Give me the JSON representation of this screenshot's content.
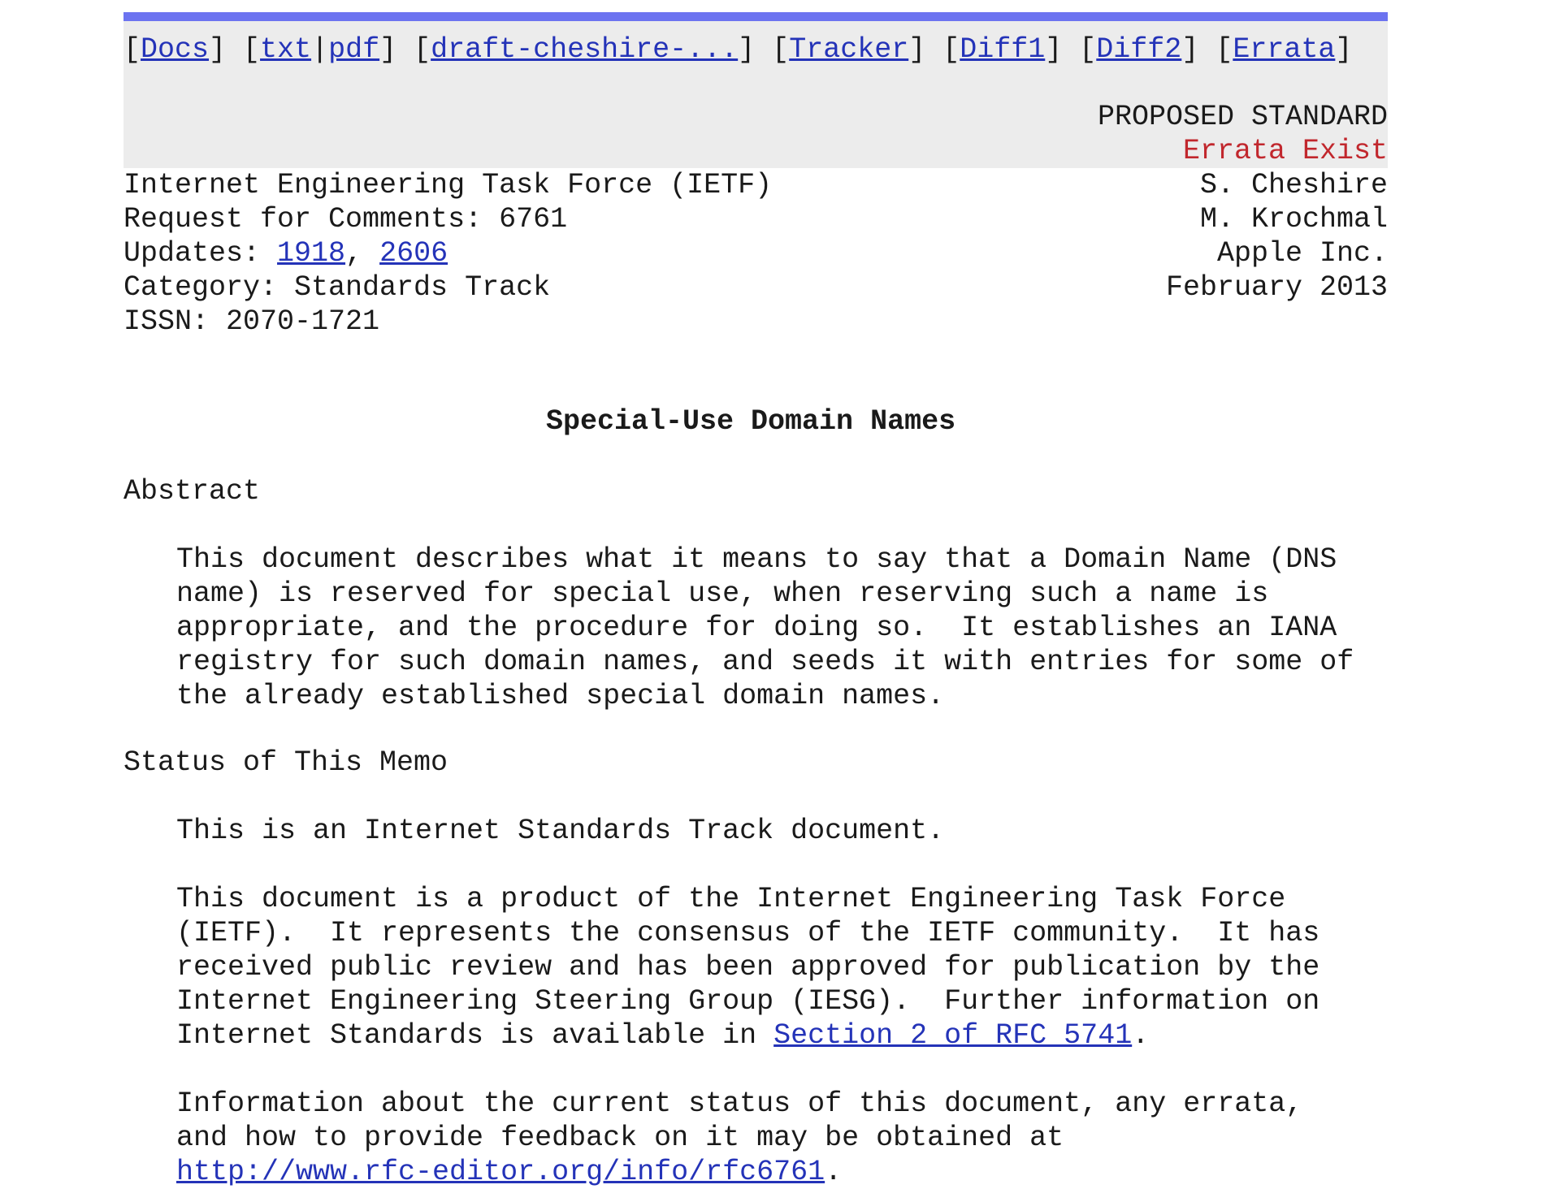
{
  "nav": {
    "docs": "Docs",
    "txt": "txt",
    "pdf": "pdf",
    "draft": "draft-cheshire-...",
    "tracker": "Tracker",
    "diff1": "Diff1",
    "diff2": "Diff2",
    "errata": "Errata"
  },
  "status": {
    "proposed": "PROPOSED STANDARD",
    "errata": "Errata Exist"
  },
  "meta": {
    "org": "Internet Engineering Task Force (IETF)",
    "rfc": "Request for Comments: 6761",
    "updates_label": "Updates: ",
    "updates": [
      "1918",
      "2606"
    ],
    "category": "Category: Standards Track",
    "issn": "ISSN: 2070-1721",
    "authors": [
      "S. Cheshire",
      "M. Krochmal",
      "Apple Inc.",
      "February 2013"
    ]
  },
  "title": "Special-Use Domain Names",
  "abstract": {
    "heading": "Abstract",
    "lines": [
      "This document describes what it means to say that a Domain Name (DNS",
      "name) is reserved for special use, when reserving such a name is",
      "appropriate, and the procedure for doing so.  It establishes an IANA",
      "registry for such domain names, and seeds it with entries for some of",
      "the already established special domain names."
    ]
  },
  "memo": {
    "heading": "Status of This Memo",
    "p1": "This is an Internet Standards Track document.",
    "p2_lines": [
      "This document is a product of the Internet Engineering Task Force",
      "(IETF).  It represents the consensus of the IETF community.  It has",
      "received public review and has been approved for publication by the",
      "Internet Engineering Steering Group (IESG).  Further information on"
    ],
    "p2_last_prefix": "Internet Standards is available in ",
    "p2_link": "Section 2 of RFC 5741",
    "p3_lines": [
      "Information about the current status of this document, any errata,",
      "and how to provide feedback on it may be obtained at"
    ],
    "p3_link": "http://www.rfc-editor.org/info/rfc6761"
  }
}
